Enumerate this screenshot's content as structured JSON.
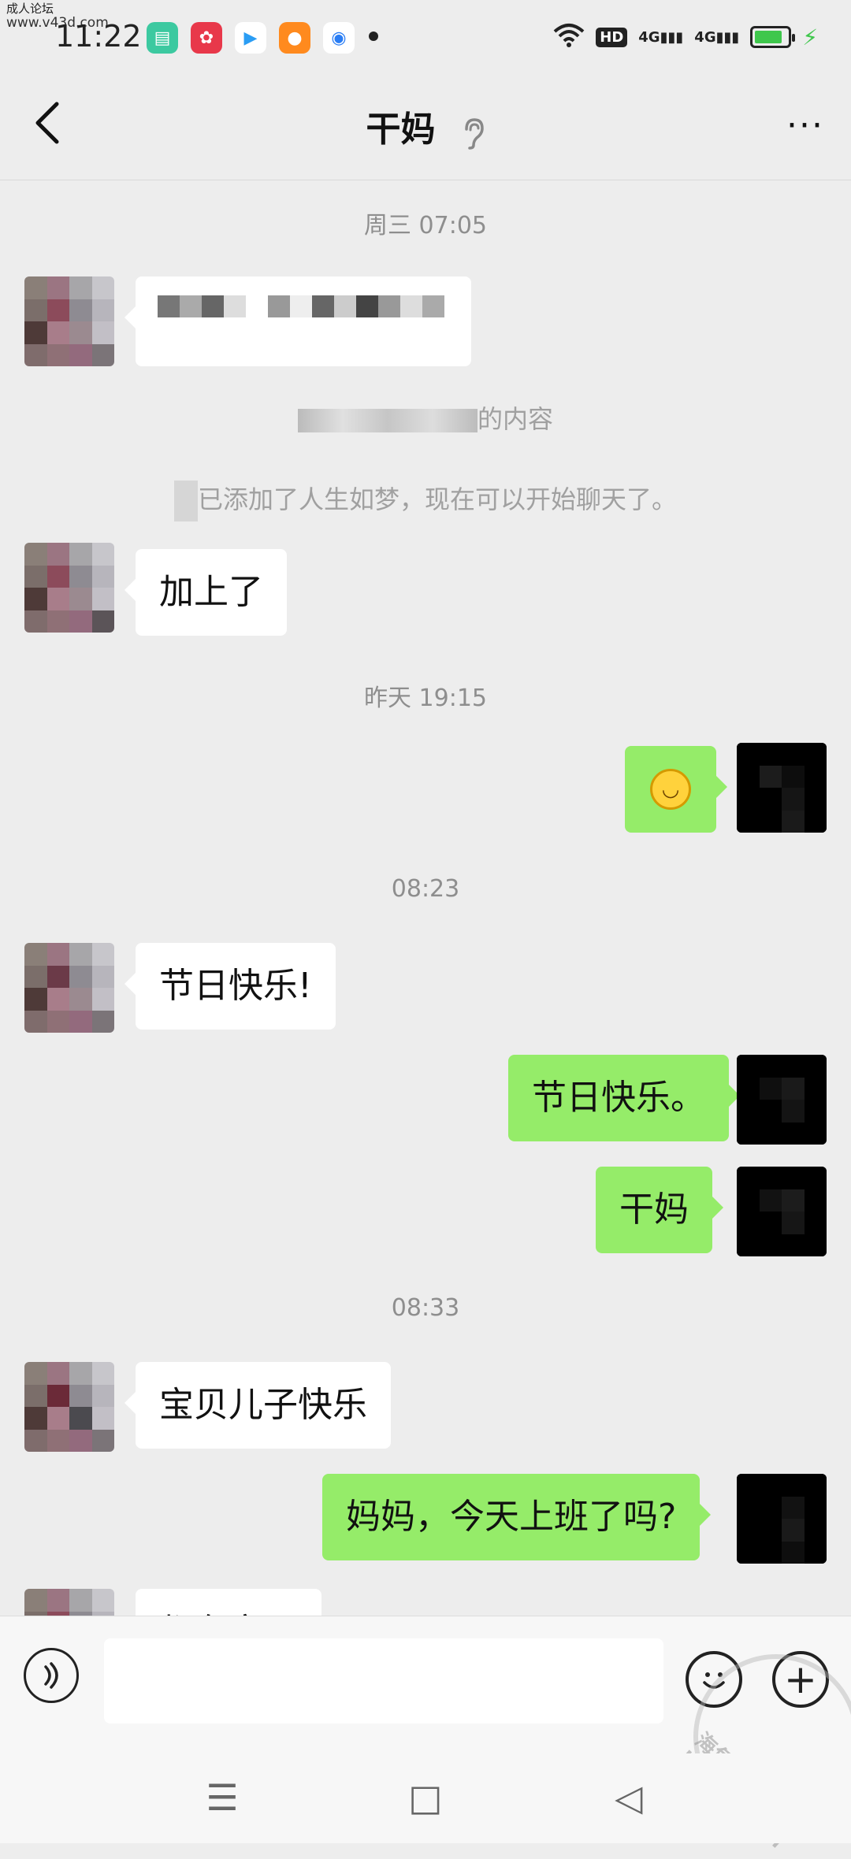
{
  "status_bar": {
    "watermark_line1": "成人论坛",
    "watermark_line2": "www.v43d.com",
    "time": "11:22",
    "app_icons": [
      "app-green-icon",
      "app-red-icon",
      "play-store-icon",
      "fox-icon",
      "blue-circle-icon"
    ],
    "hd": "HD",
    "net1": "4G",
    "net2": "4G",
    "battery_level": 0.85
  },
  "header": {
    "title": "干妈",
    "back_icon": "chevron-left",
    "ear_icon": "ear-icon",
    "more_label": "···"
  },
  "chat": {
    "ts1": "周三 07:05",
    "sys1": "的内容",
    "sys2": "已添加了人生如梦，现在可以开始聊天了。",
    "msg1": "加上了",
    "ts2": "昨天 19:15",
    "ts3": "08:23",
    "msg2": "节日快乐!",
    "msg3": "节日快乐。",
    "msg4": "干妈",
    "ts4": "08:33",
    "msg5": "宝贝儿子快乐",
    "msg6": "妈妈，今天上班了吗?",
    "msg7": "都在家呢"
  },
  "input_bar": {
    "placeholder": "",
    "emoji_icon": "emoji-icon",
    "plus_label": "+"
  },
  "watermark": {
    "text": "海角社区 haijiao.com"
  },
  "nav": {
    "menu": "☰",
    "home": "□",
    "back": "◁"
  }
}
